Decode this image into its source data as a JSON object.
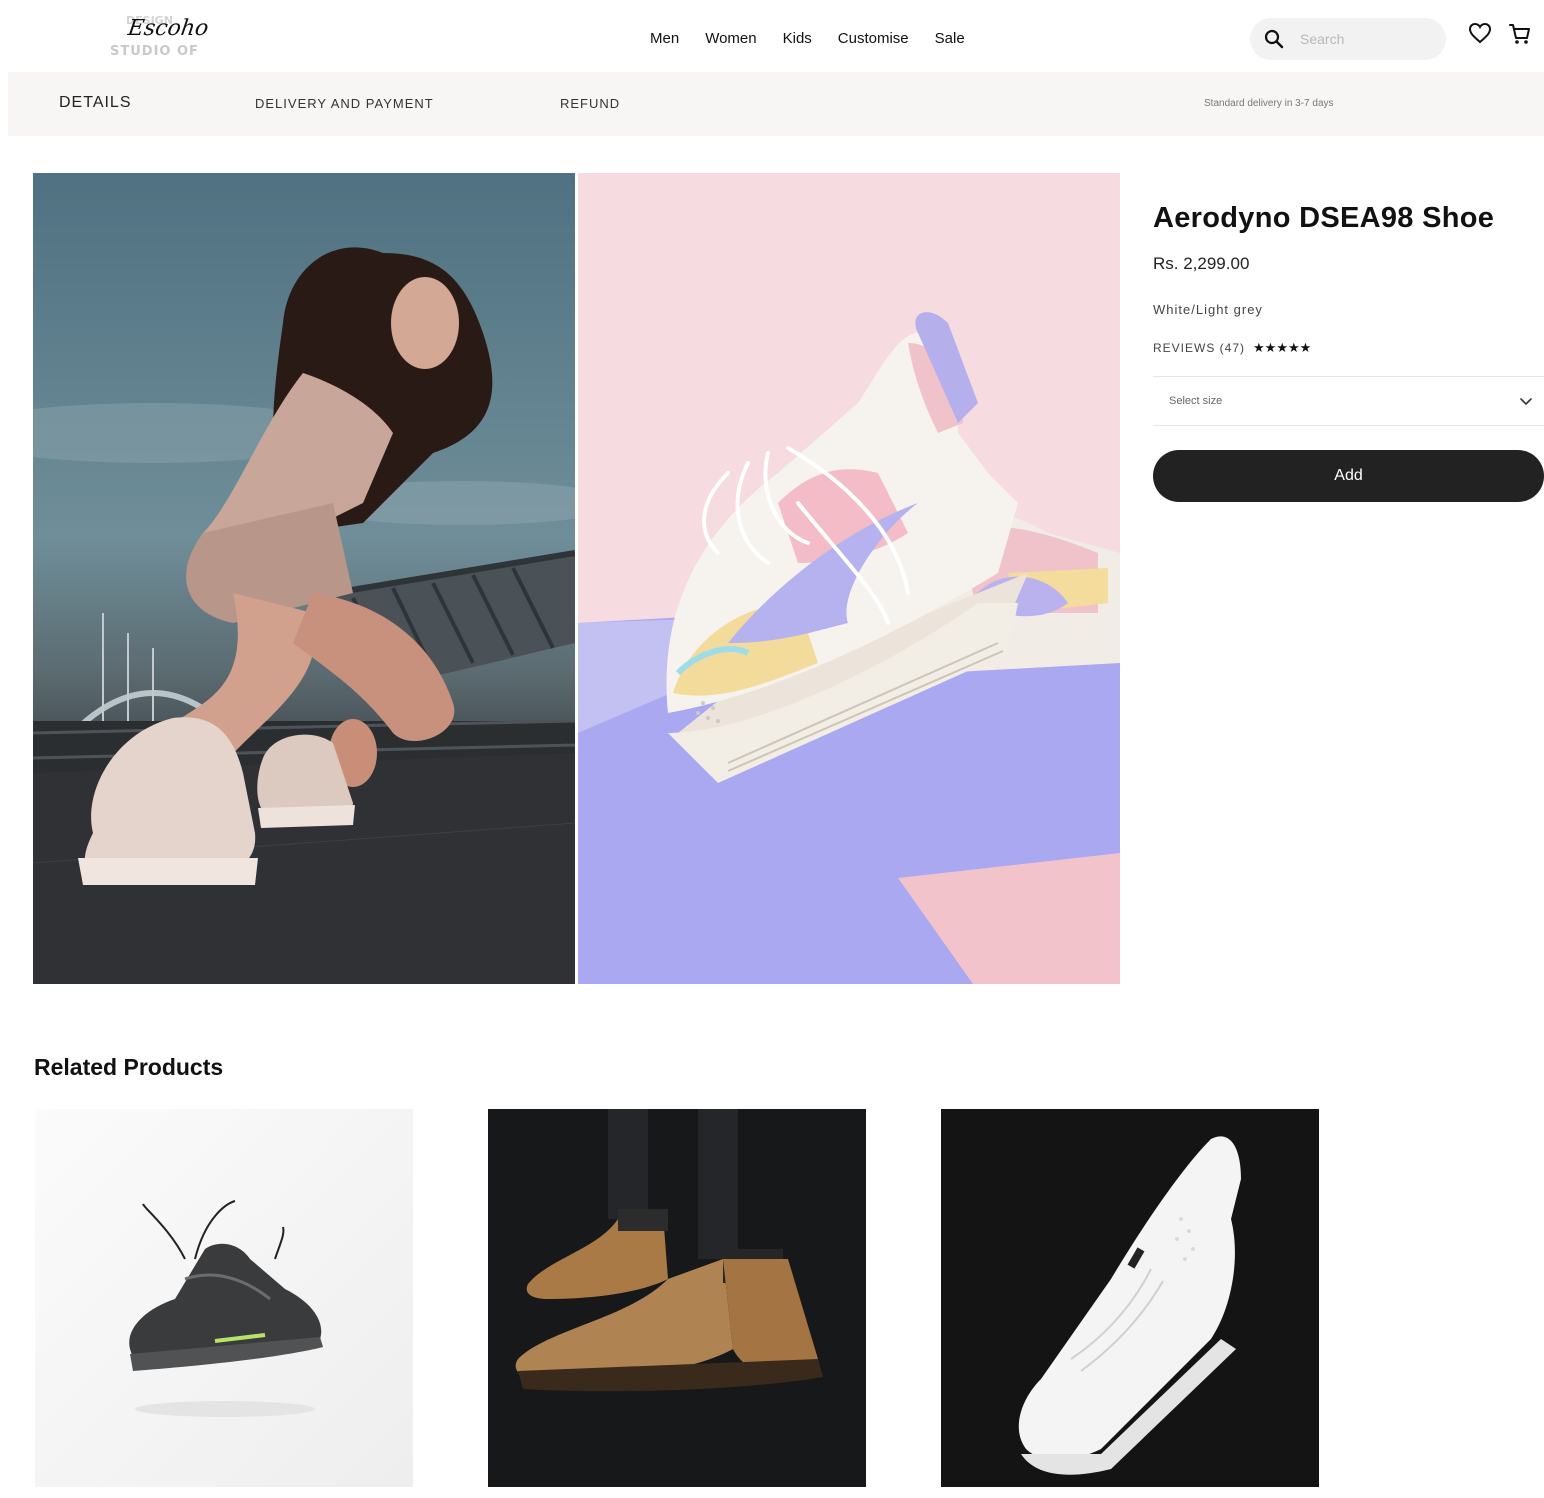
{
  "brand": {
    "script": "Escoho",
    "tagline": "STUDIO OF",
    "top_word": "DESIGN"
  },
  "nav": {
    "items": [
      "Men",
      "Women",
      "Kids",
      "Customise",
      "Sale"
    ]
  },
  "search": {
    "placeholder": "Search"
  },
  "tabs": {
    "details": "DETAILS",
    "delivery": "DELIVERY AND PAYMENT",
    "refund": "REFUND",
    "delivery_note": "Standard delivery in 3-7 days"
  },
  "product": {
    "title": "Aerodyno DSEA98 Shoe",
    "price": "Rs. 2,299.00",
    "color": "White/Light grey",
    "reviews_label": "REVIEWS (47)",
    "rating_stars": 5,
    "size_placeholder": "Select size",
    "add_label": "Add"
  },
  "related": {
    "title": "Related Products"
  },
  "colors": {
    "accent": "#222222",
    "tabbar_bg": "#f7f6f4",
    "search_bg": "#f2f2f2"
  },
  "icons": {
    "search": "search-icon",
    "wishlist": "heart-icon",
    "cart": "cart-icon",
    "dropdown": "chevron-down-icon"
  }
}
